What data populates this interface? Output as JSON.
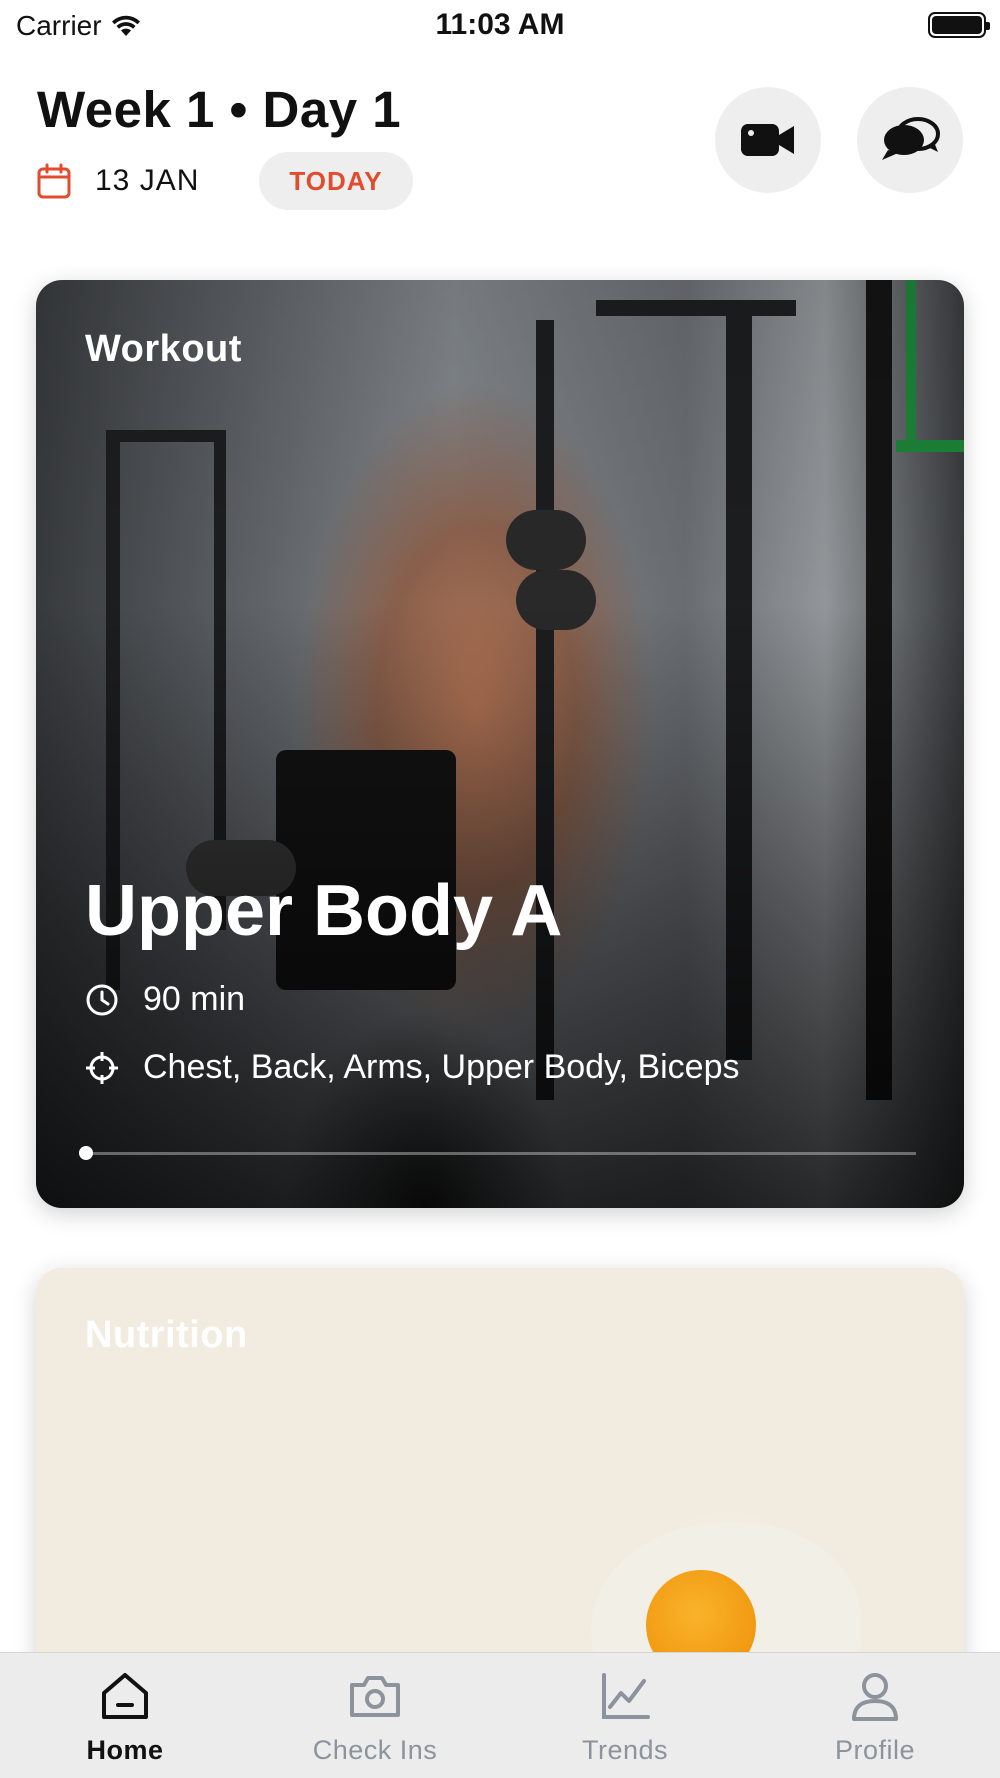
{
  "status_bar": {
    "carrier": "Carrier",
    "time": "11:03 AM",
    "wifi_icon": "wifi-icon",
    "battery_icon": "battery-icon"
  },
  "header": {
    "title": "Week 1 • Day 1",
    "date": "13 JAN",
    "today_label": "TODAY",
    "calendar_icon": "calendar-icon",
    "video_icon": "video-camera-icon",
    "chat_icon": "chat-bubbles-icon"
  },
  "workout_card": {
    "label": "Workout",
    "title": "Upper Body A",
    "duration": "90 min",
    "targets": "Chest, Back, Arms, Upper Body, Biceps",
    "progress": 0,
    "clock_icon": "clock-icon",
    "target_icon": "crosshair-icon"
  },
  "nutrition_card": {
    "label": "Nutrition"
  },
  "tab_bar": {
    "tabs": [
      {
        "label": "Home",
        "icon": "home-icon",
        "active": true
      },
      {
        "label": "Check Ins",
        "icon": "camera-icon",
        "active": false
      },
      {
        "label": "Trends",
        "icon": "chart-line-icon",
        "active": false
      },
      {
        "label": "Profile",
        "icon": "user-icon",
        "active": false
      }
    ]
  },
  "colors": {
    "accent": "#e24b2c",
    "pill_bg": "#eeeeee",
    "tab_inactive": "#8d939c",
    "tab_active": "#111111"
  }
}
